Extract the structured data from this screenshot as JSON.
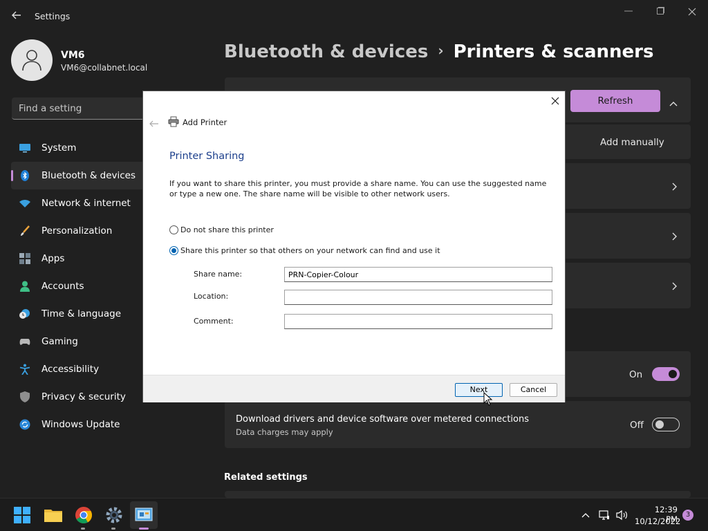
{
  "window": {
    "title": "Settings"
  },
  "user": {
    "name": "VM6",
    "email": "VM6@collabnet.local"
  },
  "search": {
    "placeholder": "Find a setting"
  },
  "nav": {
    "items": [
      {
        "label": "System",
        "icon": "monitor-icon"
      },
      {
        "label": "Bluetooth & devices",
        "icon": "bluetooth-icon",
        "active": true
      },
      {
        "label": "Network & internet",
        "icon": "wifi-icon"
      },
      {
        "label": "Personalization",
        "icon": "brush-icon"
      },
      {
        "label": "Apps",
        "icon": "apps-icon"
      },
      {
        "label": "Accounts",
        "icon": "person-icon"
      },
      {
        "label": "Time & language",
        "icon": "clock-globe-icon"
      },
      {
        "label": "Gaming",
        "icon": "controller-icon"
      },
      {
        "label": "Accessibility",
        "icon": "accessibility-icon"
      },
      {
        "label": "Privacy & security",
        "icon": "shield-icon"
      },
      {
        "label": "Windows Update",
        "icon": "update-icon"
      }
    ]
  },
  "breadcrumb": {
    "parent": "Bluetooth & devices",
    "separator": "›",
    "current": "Printers & scanners"
  },
  "main": {
    "refresh_label": "Refresh",
    "add_manually_label": "Add manually",
    "toggle1": {
      "state_label": "On",
      "on": true
    },
    "metered": {
      "title": "Download drivers and device software over metered connections",
      "subtitle": "Data charges may apply",
      "state_label": "Off",
      "on": false
    },
    "related_heading": "Related settings"
  },
  "dialog": {
    "title": "Add Printer",
    "heading": "Printer Sharing",
    "description": "If you want to share this printer, you must provide a share name. You can use the suggested name or type a new one. The share name will be visible to other network users.",
    "option_no_share": "Do not share this printer",
    "option_share": "Share this printer so that others on your network can find and use it",
    "selected_option": "share",
    "share_name_label": "Share name:",
    "share_name_value": "PRN-Copier-Colour",
    "location_label": "Location:",
    "location_value": "",
    "comment_label": "Comment:",
    "comment_value": "",
    "next_label": "Next",
    "cancel_label": "Cancel"
  },
  "taskbar": {
    "apps": [
      "windows-start-icon",
      "file-explorer-icon",
      "chrome-icon",
      "settings-gear-icon",
      "control-panel-icon"
    ],
    "time": "12:39 PM",
    "date": "10/12/2022",
    "notification_count": "3"
  },
  "colors": {
    "accent": "#c58bd8",
    "background": "#202020",
    "card": "#2b2b2b",
    "dialog_heading": "#1c3f8c"
  }
}
